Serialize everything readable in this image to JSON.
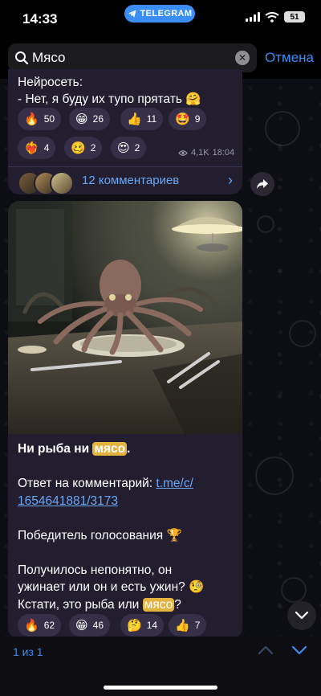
{
  "status_bar": {
    "time": "14:33",
    "app_pill": "TELEGRAM",
    "battery": "51"
  },
  "search": {
    "query": "Мясо",
    "cancel_label": "Отмена"
  },
  "message1": {
    "lines": [
      "Нейросеть:",
      "- Нет, я буду их тупо прятать 🤗"
    ],
    "reactions": [
      {
        "emoji": "🔥",
        "count": "50"
      },
      {
        "emoji": "😁",
        "count": "26"
      },
      {
        "emoji": "👍",
        "count": "11"
      },
      {
        "emoji": "🤩",
        "count": "9"
      },
      {
        "emoji": "❤️‍🔥",
        "count": "4"
      },
      {
        "emoji": "🥴",
        "count": "2"
      },
      {
        "emoji": "😍",
        "count": "2"
      }
    ],
    "views": "4,1K",
    "time": "18:04",
    "comments_label": "12 комментариев"
  },
  "message2": {
    "title_prefix": "Ни рыба ни ",
    "title_highlight": "мясо",
    "title_suffix": ".",
    "reply_prefix": "Ответ на комментарий: ",
    "reply_link_1": "t.me/c/",
    "reply_link_2": "1654641881/3173",
    "poll_text": "Победитель голосования 🏆",
    "body_line1": "Получилось непонятно, он",
    "body_line2": "ужинает или он и есть ужин? 🧐",
    "body_line3_prefix": "Кстати, это рыба или ",
    "body_line3_highlight": "мясо",
    "body_line3_suffix": "?",
    "reactions": [
      {
        "emoji": "🔥",
        "count": "62"
      },
      {
        "emoji": "😁",
        "count": "46"
      },
      {
        "emoji": "🤔",
        "count": "14"
      },
      {
        "emoji": "👍",
        "count": "7"
      }
    ]
  },
  "bottom_bar": {
    "counter": "1 из 1"
  },
  "colors": {
    "accent": "#3e8ef7",
    "link": "#6aa7f5",
    "highlight": "#e3b340",
    "bubble": "#221e30"
  }
}
